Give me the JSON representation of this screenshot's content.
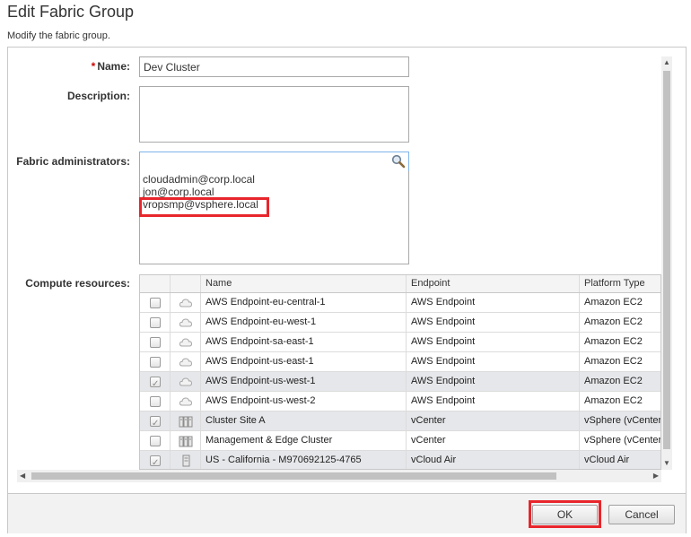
{
  "header": {
    "title": "Edit Fabric Group",
    "subtitle": "Modify the fabric group."
  },
  "form": {
    "name_required_marker": "*",
    "name_label": "Name:",
    "name_value": "Dev Cluster",
    "description_label": "Description:",
    "description_value": "",
    "fabric_admins_label": "Fabric administrators:",
    "fabric_admins_search_value": "",
    "fabric_admins": [
      "cloudadmin@corp.local",
      "jon@corp.local",
      "vropsmp@vsphere.local"
    ],
    "compute_resources_label": "Compute resources:"
  },
  "table": {
    "columns": [
      "Name",
      "Endpoint",
      "Platform Type"
    ],
    "rows": [
      {
        "checked": false,
        "icon": "cloud-icon",
        "name": "AWS Endpoint-eu-central-1",
        "endpoint": "AWS Endpoint",
        "platform": "Amazon EC2"
      },
      {
        "checked": false,
        "icon": "cloud-icon",
        "name": "AWS Endpoint-eu-west-1",
        "endpoint": "AWS Endpoint",
        "platform": "Amazon EC2"
      },
      {
        "checked": false,
        "icon": "cloud-icon",
        "name": "AWS Endpoint-sa-east-1",
        "endpoint": "AWS Endpoint",
        "platform": "Amazon EC2"
      },
      {
        "checked": false,
        "icon": "cloud-icon",
        "name": "AWS Endpoint-us-east-1",
        "endpoint": "AWS Endpoint",
        "platform": "Amazon EC2"
      },
      {
        "checked": true,
        "icon": "cloud-icon",
        "name": "AWS Endpoint-us-west-1",
        "endpoint": "AWS Endpoint",
        "platform": "Amazon EC2"
      },
      {
        "checked": false,
        "icon": "cloud-icon",
        "name": "AWS Endpoint-us-west-2",
        "endpoint": "AWS Endpoint",
        "platform": "Amazon EC2"
      },
      {
        "checked": true,
        "icon": "cluster-icon",
        "name": "Cluster Site A",
        "endpoint": "vCenter",
        "platform": "vSphere (vCenter)"
      },
      {
        "checked": false,
        "icon": "cluster-icon",
        "name": "Management & Edge Cluster",
        "endpoint": "vCenter",
        "platform": "vSphere (vCenter)"
      },
      {
        "checked": true,
        "icon": "vcloud-air-icon",
        "name": "US - California - M970692125-4765",
        "endpoint": "vCloud Air",
        "platform": "vCloud Air"
      }
    ]
  },
  "footer": {
    "ok_label": "OK",
    "cancel_label": "Cancel"
  },
  "colors": {
    "highlight": "#e8262c",
    "selected_row": "#e6e7ea"
  }
}
